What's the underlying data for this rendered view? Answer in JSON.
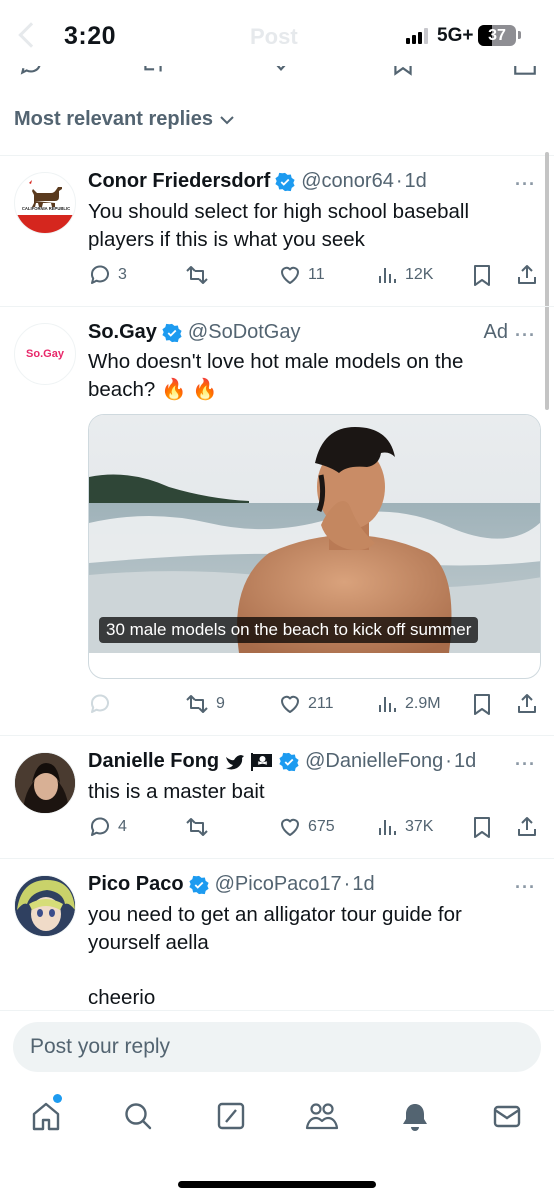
{
  "status_bar": {
    "time": "3:20",
    "network": "5G+",
    "battery": "37",
    "faded_title": "Post"
  },
  "replies_sort": {
    "label": "Most relevant replies"
  },
  "posts": [
    {
      "name": "Conor Friedersdorf",
      "handle": "@conor64",
      "time": "1d",
      "avatar_text": "CALIFORNIA REPUBLIC",
      "text": "You should select for high school baseball players if this is what you seek",
      "replies": "3",
      "reposts": "",
      "likes": "11",
      "views": "12K"
    },
    {
      "name": "So.Gay",
      "handle": "@SoDotGay",
      "ad_label": "Ad",
      "avatar_text": "So.Gay",
      "text": "Who doesn't love hot male models on the beach? 🔥 🔥",
      "media_caption": "30 male models on the beach to kick off summer",
      "replies": "",
      "reposts": "9",
      "likes": "211",
      "views": "2.9M"
    },
    {
      "name": "Danielle Fong",
      "handle": "@DanielleFong",
      "time": "1d",
      "text": "this is a master bait",
      "replies": "4",
      "reposts": "",
      "likes": "675",
      "views": "37K"
    },
    {
      "name": "Pico Paco",
      "handle": "@PicoPaco17",
      "time": "1d",
      "text_line1": "you need to get an alligator tour guide for yourself aella",
      "text_line2": "cheerio"
    }
  ],
  "reply_box": {
    "placeholder": "Post your reply"
  },
  "tabs": [
    "home-icon",
    "search-icon",
    "grok-icon",
    "communities-icon",
    "notifications-icon",
    "messages-icon"
  ],
  "colors": {
    "accent": "#1d9bf0",
    "text_secondary": "#536471",
    "fire": "#ff6a00"
  }
}
